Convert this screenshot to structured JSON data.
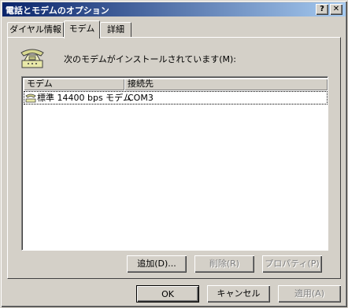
{
  "window": {
    "title": "電話とモデムのオプション",
    "help_glyph": "?",
    "close_glyph": "✕"
  },
  "tabs": [
    {
      "label": "ダイヤル情報",
      "active": false
    },
    {
      "label": "モデム",
      "active": true
    },
    {
      "label": "詳細",
      "active": false
    }
  ],
  "modem_page": {
    "heading": "次のモデムがインストールされています(M):",
    "icon": "telephone-icon",
    "columns": {
      "model": "モデム",
      "port": "接続先"
    },
    "rows": [
      {
        "model": "標準 14400 bps モデム",
        "port": "COM3",
        "icon": "modem-icon"
      }
    ]
  },
  "buttons": {
    "add": "追加(D)...",
    "remove": "削除(R)",
    "properties": "プロパティ(P)",
    "ok": "OK",
    "cancel": "キャンセル",
    "apply": "適用(A)"
  },
  "colors": {
    "title_gradient_start": "#0a246a",
    "title_gradient_end": "#a6caf0",
    "face": "#d4d0c8"
  }
}
